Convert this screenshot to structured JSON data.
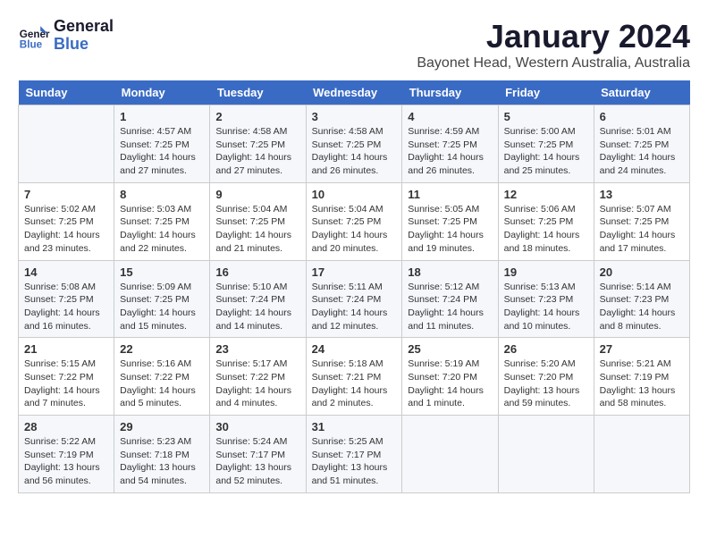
{
  "header": {
    "logo_line1": "General",
    "logo_line2": "Blue",
    "month": "January 2024",
    "location": "Bayonet Head, Western Australia, Australia"
  },
  "days_of_week": [
    "Sunday",
    "Monday",
    "Tuesday",
    "Wednesday",
    "Thursday",
    "Friday",
    "Saturday"
  ],
  "weeks": [
    [
      {
        "date": "",
        "info": ""
      },
      {
        "date": "1",
        "info": "Sunrise: 4:57 AM\nSunset: 7:25 PM\nDaylight: 14 hours\nand 27 minutes."
      },
      {
        "date": "2",
        "info": "Sunrise: 4:58 AM\nSunset: 7:25 PM\nDaylight: 14 hours\nand 27 minutes."
      },
      {
        "date": "3",
        "info": "Sunrise: 4:58 AM\nSunset: 7:25 PM\nDaylight: 14 hours\nand 26 minutes."
      },
      {
        "date": "4",
        "info": "Sunrise: 4:59 AM\nSunset: 7:25 PM\nDaylight: 14 hours\nand 26 minutes."
      },
      {
        "date": "5",
        "info": "Sunrise: 5:00 AM\nSunset: 7:25 PM\nDaylight: 14 hours\nand 25 minutes."
      },
      {
        "date": "6",
        "info": "Sunrise: 5:01 AM\nSunset: 7:25 PM\nDaylight: 14 hours\nand 24 minutes."
      }
    ],
    [
      {
        "date": "7",
        "info": "Sunrise: 5:02 AM\nSunset: 7:25 PM\nDaylight: 14 hours\nand 23 minutes."
      },
      {
        "date": "8",
        "info": "Sunrise: 5:03 AM\nSunset: 7:25 PM\nDaylight: 14 hours\nand 22 minutes."
      },
      {
        "date": "9",
        "info": "Sunrise: 5:04 AM\nSunset: 7:25 PM\nDaylight: 14 hours\nand 21 minutes."
      },
      {
        "date": "10",
        "info": "Sunrise: 5:04 AM\nSunset: 7:25 PM\nDaylight: 14 hours\nand 20 minutes."
      },
      {
        "date": "11",
        "info": "Sunrise: 5:05 AM\nSunset: 7:25 PM\nDaylight: 14 hours\nand 19 minutes."
      },
      {
        "date": "12",
        "info": "Sunrise: 5:06 AM\nSunset: 7:25 PM\nDaylight: 14 hours\nand 18 minutes."
      },
      {
        "date": "13",
        "info": "Sunrise: 5:07 AM\nSunset: 7:25 PM\nDaylight: 14 hours\nand 17 minutes."
      }
    ],
    [
      {
        "date": "14",
        "info": "Sunrise: 5:08 AM\nSunset: 7:25 PM\nDaylight: 14 hours\nand 16 minutes."
      },
      {
        "date": "15",
        "info": "Sunrise: 5:09 AM\nSunset: 7:25 PM\nDaylight: 14 hours\nand 15 minutes."
      },
      {
        "date": "16",
        "info": "Sunrise: 5:10 AM\nSunset: 7:24 PM\nDaylight: 14 hours\nand 14 minutes."
      },
      {
        "date": "17",
        "info": "Sunrise: 5:11 AM\nSunset: 7:24 PM\nDaylight: 14 hours\nand 12 minutes."
      },
      {
        "date": "18",
        "info": "Sunrise: 5:12 AM\nSunset: 7:24 PM\nDaylight: 14 hours\nand 11 minutes."
      },
      {
        "date": "19",
        "info": "Sunrise: 5:13 AM\nSunset: 7:23 PM\nDaylight: 14 hours\nand 10 minutes."
      },
      {
        "date": "20",
        "info": "Sunrise: 5:14 AM\nSunset: 7:23 PM\nDaylight: 14 hours\nand 8 minutes."
      }
    ],
    [
      {
        "date": "21",
        "info": "Sunrise: 5:15 AM\nSunset: 7:22 PM\nDaylight: 14 hours\nand 7 minutes."
      },
      {
        "date": "22",
        "info": "Sunrise: 5:16 AM\nSunset: 7:22 PM\nDaylight: 14 hours\nand 5 minutes."
      },
      {
        "date": "23",
        "info": "Sunrise: 5:17 AM\nSunset: 7:22 PM\nDaylight: 14 hours\nand 4 minutes."
      },
      {
        "date": "24",
        "info": "Sunrise: 5:18 AM\nSunset: 7:21 PM\nDaylight: 14 hours\nand 2 minutes."
      },
      {
        "date": "25",
        "info": "Sunrise: 5:19 AM\nSunset: 7:20 PM\nDaylight: 14 hours\nand 1 minute."
      },
      {
        "date": "26",
        "info": "Sunrise: 5:20 AM\nSunset: 7:20 PM\nDaylight: 13 hours\nand 59 minutes."
      },
      {
        "date": "27",
        "info": "Sunrise: 5:21 AM\nSunset: 7:19 PM\nDaylight: 13 hours\nand 58 minutes."
      }
    ],
    [
      {
        "date": "28",
        "info": "Sunrise: 5:22 AM\nSunset: 7:19 PM\nDaylight: 13 hours\nand 56 minutes."
      },
      {
        "date": "29",
        "info": "Sunrise: 5:23 AM\nSunset: 7:18 PM\nDaylight: 13 hours\nand 54 minutes."
      },
      {
        "date": "30",
        "info": "Sunrise: 5:24 AM\nSunset: 7:17 PM\nDaylight: 13 hours\nand 52 minutes."
      },
      {
        "date": "31",
        "info": "Sunrise: 5:25 AM\nSunset: 7:17 PM\nDaylight: 13 hours\nand 51 minutes."
      },
      {
        "date": "",
        "info": ""
      },
      {
        "date": "",
        "info": ""
      },
      {
        "date": "",
        "info": ""
      }
    ]
  ]
}
